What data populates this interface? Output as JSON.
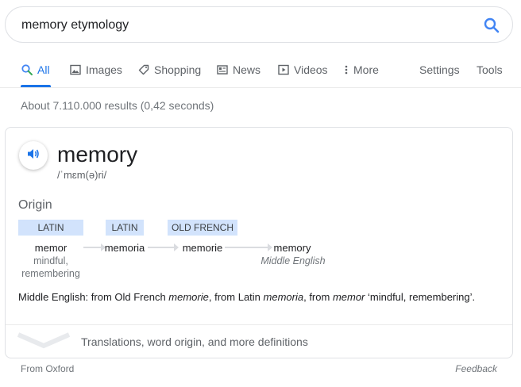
{
  "search": {
    "query": "memory etymology"
  },
  "tabs": [
    {
      "label": "All",
      "icon": "search-icon",
      "active": true
    },
    {
      "label": "Images",
      "icon": "images-icon"
    },
    {
      "label": "Shopping",
      "icon": "tag-icon"
    },
    {
      "label": "News",
      "icon": "news-icon"
    },
    {
      "label": "Videos",
      "icon": "video-icon"
    },
    {
      "label": "More",
      "icon": "more-vert-icon"
    },
    {
      "label": "Settings"
    },
    {
      "label": "Tools"
    }
  ],
  "stats": "About 7.110.000 results (0,42 seconds)",
  "card": {
    "word": "memory",
    "phonetic": "/ˈmɛm(ə)ri/",
    "origin_label": "Origin",
    "etymology": [
      {
        "language": "LATIN",
        "word": "memor",
        "gloss": "mindful,\nremembering"
      },
      {
        "language": "LATIN",
        "word": "memoria",
        "gloss": ""
      },
      {
        "language": "OLD FRENCH",
        "word": "memorie",
        "gloss": ""
      },
      {
        "language": "",
        "word": "memory",
        "gloss": "Middle English"
      }
    ],
    "definition": {
      "p1": "Middle English: from Old French ",
      "w1": "memorie",
      "p2": ", from Latin ",
      "w2": "memoria",
      "p3": ", from ",
      "w3": "memor",
      "p4": " ‘mindful, remembering’."
    },
    "more_link": "Translations, word origin, and more definitions"
  },
  "footer": {
    "source": "From Oxford",
    "feedback": "Feedback"
  },
  "colors": {
    "accent": "#1a73e8",
    "chip": "#d2e3fc"
  }
}
